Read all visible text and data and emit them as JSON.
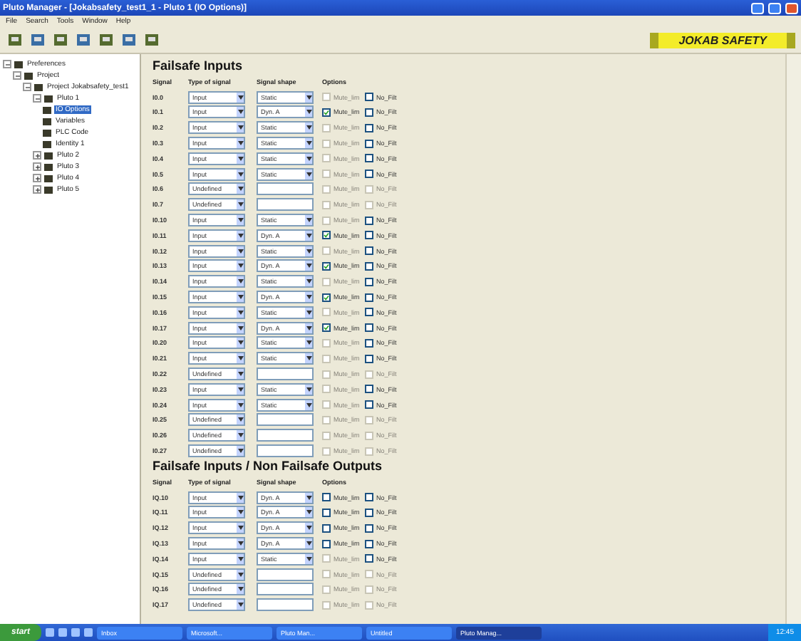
{
  "window": {
    "title": "Pluto Manager - [Jokabsafety_test1_1 - Pluto 1 (IO Options)]"
  },
  "menu": [
    "File",
    "Search",
    "Tools",
    "Window",
    "Help"
  ],
  "logo": "JOKAB SAFETY",
  "tree": [
    {
      "label": "Preferences",
      "expanded": true,
      "children": [
        {
          "label": "Project",
          "expanded": true,
          "children": [
            {
              "label": "Project Jokabsafety_test1",
              "expanded": true,
              "children": [
                {
                  "label": "Pluto 1",
                  "expanded": true,
                  "children": [
                    {
                      "label": "IO Options",
                      "selected": true
                    },
                    {
                      "label": "Variables",
                      "selected": false
                    },
                    {
                      "label": "PLC Code",
                      "selected": false
                    },
                    {
                      "label": "Identity 1",
                      "selected": false
                    }
                  ]
                },
                {
                  "label": "Pluto 2",
                  "expanded": false
                },
                {
                  "label": "Pluto 3",
                  "expanded": false
                },
                {
                  "label": "Pluto 4",
                  "expanded": false
                },
                {
                  "label": "Pluto 5",
                  "expanded": false
                }
              ]
            }
          ]
        }
      ]
    }
  ],
  "sections": [
    {
      "title": "Failsafe Inputs",
      "columns": [
        "Signal",
        "Type of signal",
        "Signal shape",
        "Options"
      ],
      "rows": [
        {
          "signal": "I0.0",
          "type": "Input",
          "shape": "Static",
          "options": [
            {
              "label": "Mute_lim",
              "checked": false,
              "disabled": true
            },
            {
              "label": "No_Filt",
              "checked": false,
              "disabled": false
            }
          ]
        },
        {
          "signal": "I0.1",
          "type": "Input",
          "shape": "Dyn. A",
          "options": [
            {
              "label": "Mute_lim",
              "checked": true,
              "disabled": false
            },
            {
              "label": "No_Filt",
              "checked": false,
              "disabled": false
            }
          ]
        },
        {
          "signal": "I0.2",
          "type": "Input",
          "shape": "Static",
          "options": [
            {
              "label": "Mute_lim",
              "checked": false,
              "disabled": true
            },
            {
              "label": "No_Filt",
              "checked": false,
              "disabled": false
            }
          ]
        },
        {
          "signal": "I0.3",
          "type": "Input",
          "shape": "Static",
          "options": [
            {
              "label": "Mute_lim",
              "checked": false,
              "disabled": true
            },
            {
              "label": "No_Filt",
              "checked": false,
              "disabled": false
            }
          ]
        },
        {
          "signal": "I0.4",
          "type": "Input",
          "shape": "Static",
          "options": [
            {
              "label": "Mute_lim",
              "checked": false,
              "disabled": true
            },
            {
              "label": "No_Filt",
              "checked": false,
              "disabled": false
            }
          ]
        },
        {
          "signal": "I0.5",
          "type": "Input",
          "shape": "Static",
          "options": [
            {
              "label": "Mute_lim",
              "checked": false,
              "disabled": true
            },
            {
              "label": "No_Filt",
              "checked": false,
              "disabled": false
            }
          ]
        },
        {
          "signal": "I0.6",
          "type": "Undefined",
          "options": [
            {
              "label": "Mute_lim",
              "checked": false,
              "disabled": true
            },
            {
              "label": "No_Filt",
              "checked": false,
              "disabled": true
            }
          ]
        },
        {
          "signal": "I0.7",
          "type": "Undefined",
          "options": [
            {
              "label": "Mute_lim",
              "checked": false,
              "disabled": true
            },
            {
              "label": "No_Filt",
              "checked": false,
              "disabled": true
            }
          ]
        },
        {
          "signal": "I0.10",
          "type": "Input",
          "shape": "Static",
          "options": [
            {
              "label": "Mute_lim",
              "checked": false,
              "disabled": true
            },
            {
              "label": "No_Filt",
              "checked": false,
              "disabled": false
            }
          ]
        },
        {
          "signal": "I0.11",
          "type": "Input",
          "shape": "Dyn. A",
          "options": [
            {
              "label": "Mute_lim",
              "checked": true,
              "disabled": false
            },
            {
              "label": "No_Filt",
              "checked": false,
              "disabled": false
            }
          ]
        },
        {
          "signal": "I0.12",
          "type": "Input",
          "shape": "Static",
          "options": [
            {
              "label": "Mute_lim",
              "checked": false,
              "disabled": true
            },
            {
              "label": "No_Filt",
              "checked": false,
              "disabled": false
            }
          ]
        },
        {
          "signal": "I0.13",
          "type": "Input",
          "shape": "Dyn. A",
          "options": [
            {
              "label": "Mute_lim",
              "checked": true,
              "disabled": false
            },
            {
              "label": "No_Filt",
              "checked": false,
              "disabled": false
            }
          ]
        },
        {
          "signal": "I0.14",
          "type": "Input",
          "shape": "Static",
          "options": [
            {
              "label": "Mute_lim",
              "checked": false,
              "disabled": true
            },
            {
              "label": "No_Filt",
              "checked": false,
              "disabled": false
            }
          ]
        },
        {
          "signal": "I0.15",
          "type": "Input",
          "shape": "Dyn. A",
          "options": [
            {
              "label": "Mute_lim",
              "checked": true,
              "disabled": false
            },
            {
              "label": "No_Filt",
              "checked": false,
              "disabled": false
            }
          ]
        },
        {
          "signal": "I0.16",
          "type": "Input",
          "shape": "Static",
          "options": [
            {
              "label": "Mute_lim",
              "checked": false,
              "disabled": true
            },
            {
              "label": "No_Filt",
              "checked": false,
              "disabled": false
            }
          ]
        },
        {
          "signal": "I0.17",
          "type": "Input",
          "shape": "Dyn. A",
          "options": [
            {
              "label": "Mute_lim",
              "checked": true,
              "disabled": false
            },
            {
              "label": "No_Filt",
              "checked": false,
              "disabled": false
            }
          ]
        },
        {
          "signal": "I0.20",
          "type": "Input",
          "shape": "Static",
          "options": [
            {
              "label": "Mute_lim",
              "checked": false,
              "disabled": true
            },
            {
              "label": "No_Filt",
              "checked": false,
              "disabled": false
            }
          ]
        },
        {
          "signal": "I0.21",
          "type": "Input",
          "shape": "Static",
          "options": [
            {
              "label": "Mute_lim",
              "checked": false,
              "disabled": true
            },
            {
              "label": "No_Filt",
              "checked": false,
              "disabled": false
            }
          ]
        },
        {
          "signal": "I0.22",
          "type": "Undefined",
          "options": [
            {
              "label": "Mute_lim",
              "checked": false,
              "disabled": true
            },
            {
              "label": "No_Filt",
              "checked": false,
              "disabled": true
            }
          ]
        },
        {
          "signal": "I0.23",
          "type": "Input",
          "shape": "Static",
          "options": [
            {
              "label": "Mute_lim",
              "checked": false,
              "disabled": true
            },
            {
              "label": "No_Filt",
              "checked": false,
              "disabled": false
            }
          ]
        },
        {
          "signal": "I0.24",
          "type": "Input",
          "shape": "Static",
          "options": [
            {
              "label": "Mute_lim",
              "checked": false,
              "disabled": true
            },
            {
              "label": "No_Filt",
              "checked": false,
              "disabled": false
            }
          ]
        },
        {
          "signal": "I0.25",
          "type": "Undefined",
          "options": [
            {
              "label": "Mute_lim",
              "checked": false,
              "disabled": true
            },
            {
              "label": "No_Filt",
              "checked": false,
              "disabled": true
            }
          ]
        },
        {
          "signal": "I0.26",
          "type": "Undefined",
          "options": [
            {
              "label": "Mute_lim",
              "checked": false,
              "disabled": true
            },
            {
              "label": "No_Filt",
              "checked": false,
              "disabled": true
            }
          ]
        },
        {
          "signal": "I0.27",
          "type": "Undefined",
          "options": [
            {
              "label": "Mute_lim",
              "checked": false,
              "disabled": true
            },
            {
              "label": "No_Filt",
              "checked": false,
              "disabled": true
            }
          ]
        }
      ]
    },
    {
      "title": "Failsafe Inputs / Non Failsafe Outputs",
      "columns": [
        "Signal",
        "Type of signal",
        "Signal shape",
        "Options"
      ],
      "rows": [
        {
          "signal": "IQ.10",
          "type": "Input",
          "shape": "Dyn. A",
          "options": [
            {
              "label": "Mute_lim",
              "checked": false,
              "disabled": false
            },
            {
              "label": "No_Filt",
              "checked": false,
              "disabled": false
            }
          ]
        },
        {
          "signal": "IQ.11",
          "type": "Input",
          "shape": "Dyn. A",
          "options": [
            {
              "label": "Mute_lim",
              "checked": false,
              "disabled": false
            },
            {
              "label": "No_Filt",
              "checked": false,
              "disabled": false
            }
          ]
        },
        {
          "signal": "IQ.12",
          "type": "Input",
          "shape": "Dyn. A",
          "options": [
            {
              "label": "Mute_lim",
              "checked": false,
              "disabled": false
            },
            {
              "label": "No_Filt",
              "checked": false,
              "disabled": false
            }
          ]
        },
        {
          "signal": "IQ.13",
          "type": "Input",
          "shape": "Dyn. A",
          "options": [
            {
              "label": "Mute_lim",
              "checked": false,
              "disabled": false
            },
            {
              "label": "No_Filt",
              "checked": false,
              "disabled": false
            }
          ]
        },
        {
          "signal": "IQ.14",
          "type": "Input",
          "shape": "Static",
          "options": [
            {
              "label": "Mute_lim",
              "checked": false,
              "disabled": true
            },
            {
              "label": "No_Filt",
              "checked": false,
              "disabled": false
            }
          ]
        },
        {
          "signal": "IQ.15",
          "type": "Undefined",
          "options": [
            {
              "label": "Mute_lim",
              "checked": false,
              "disabled": true
            },
            {
              "label": "No_Filt",
              "checked": false,
              "disabled": true
            }
          ]
        },
        {
          "signal": "IQ.16",
          "type": "Undefined",
          "options": [
            {
              "label": "Mute_lim",
              "checked": false,
              "disabled": true
            },
            {
              "label": "No_Filt",
              "checked": false,
              "disabled": true
            }
          ]
        },
        {
          "signal": "IQ.17",
          "type": "Undefined",
          "options": [
            {
              "label": "Mute_lim",
              "checked": false,
              "disabled": true
            },
            {
              "label": "No_Filt",
              "checked": false,
              "disabled": true
            }
          ]
        }
      ]
    }
  ],
  "taskbar": {
    "start": "start",
    "tasks": [
      {
        "label": "Inbox",
        "selected": false
      },
      {
        "label": "Microsoft...",
        "selected": false
      },
      {
        "label": "Pluto Man...",
        "selected": false
      },
      {
        "label": "Untitled",
        "selected": false
      },
      {
        "label": "Pluto Manag...",
        "selected": true
      }
    ],
    "clock": "12:45"
  }
}
